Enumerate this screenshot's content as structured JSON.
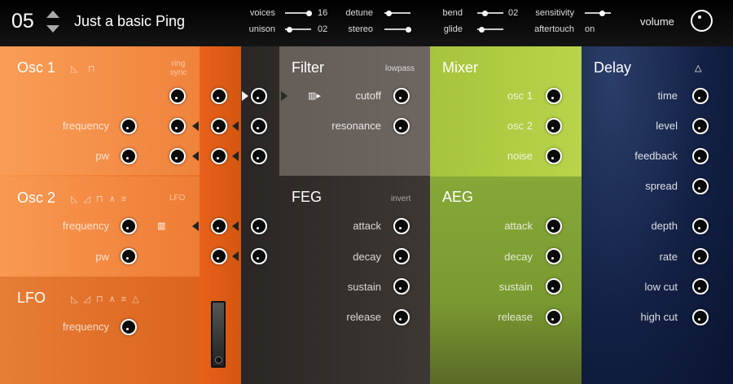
{
  "header": {
    "preset_number": "05",
    "preset_name": "Just a basic Ping",
    "params": [
      {
        "label": "voices",
        "value": "16",
        "level": 0.9
      },
      {
        "label": "unison",
        "value": "02",
        "level": 0.1
      },
      {
        "label": "detune",
        "value": "",
        "level": 0.1
      },
      {
        "label": "stereo",
        "value": "",
        "level": 0.9
      },
      {
        "label": "bend",
        "value": "02",
        "level": 0.2
      },
      {
        "label": "glide",
        "value": "",
        "level": 0.1
      },
      {
        "label": "sensitivity",
        "value": "",
        "level": 0.6
      },
      {
        "label": "aftertouch",
        "value": "on",
        "level": null
      }
    ],
    "volume_label": "volume"
  },
  "osc1": {
    "title": "Osc 1",
    "ring_sync": "ring\nsync",
    "frequency": "frequency",
    "pw": "pw",
    "shapes": [
      "ramp",
      "square"
    ]
  },
  "osc2": {
    "title": "Osc 2",
    "frequency": "frequency",
    "pw": "pw",
    "lfo": "LFO",
    "shapes": [
      "ramp",
      "saw",
      "square",
      "triangle",
      "noise"
    ]
  },
  "lfo": {
    "title": "LFO",
    "frequency": "frequency",
    "shapes": [
      "ramp",
      "saw",
      "square",
      "triangle",
      "noise",
      "sync"
    ]
  },
  "filter": {
    "title": "Filter",
    "mode": "lowpass",
    "cutoff": "cutoff",
    "resonance": "resonance"
  },
  "feg": {
    "title": "FEG",
    "invert": "invert",
    "attack": "attack",
    "decay": "decay",
    "sustain": "sustain",
    "release": "release"
  },
  "mixer": {
    "title": "Mixer",
    "osc1": "osc 1",
    "osc2": "osc 2",
    "noise": "noise"
  },
  "aeg": {
    "title": "AEG",
    "attack": "attack",
    "decay": "decay",
    "sustain": "sustain",
    "release": "release"
  },
  "delay": {
    "title": "Delay",
    "time": "time",
    "level": "level",
    "feedback": "feedback",
    "spread": "spread",
    "depth": "depth",
    "rate": "rate",
    "low_cut": "low cut",
    "high_cut": "high cut"
  },
  "colors": {
    "osc": "#f28a3c",
    "osc_dark": "#e0601a",
    "filter": "#3a3532",
    "mixer": "#a8c640",
    "delay": "#16254a"
  }
}
